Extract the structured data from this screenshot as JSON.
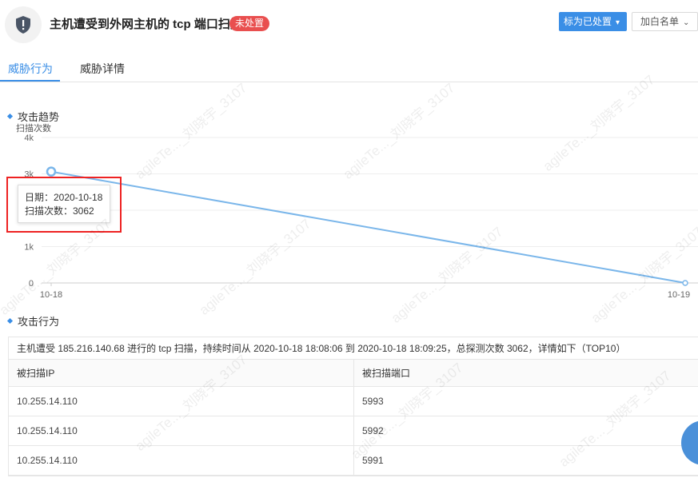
{
  "header": {
    "title": "主机遭受到外网主机的 tcp 端口扫描",
    "status_badge": "未处置",
    "mark_button": "标为已处置",
    "whitelist_button": "加白名单"
  },
  "tabs": [
    {
      "label": "威胁行为",
      "active": true
    },
    {
      "label": "威胁详情",
      "active": false
    }
  ],
  "trend_section": {
    "title": "攻击趋势",
    "y_axis_title": "扫描次数"
  },
  "tooltip": {
    "date_line": "日期：2020-10-18",
    "count_line": "扫描次数：3062"
  },
  "chart_data": {
    "type": "line",
    "x": [
      "10-18",
      "10-19"
    ],
    "series": [
      {
        "values": [
          3062,
          0
        ]
      }
    ],
    "ylabel": "扫描次数",
    "ylim": [
      0,
      4000
    ],
    "yticks": [
      "0",
      "1k",
      "2k",
      "3k",
      "4k"
    ],
    "color": "#7ab6ea",
    "grid": true
  },
  "behavior_section": {
    "title": "攻击行为",
    "summary": "主机遭受 185.216.140.68 进行的 tcp 扫描，持续时间从 2020-10-18 18:08:06 到 2020-10-18 18:09:25，总探测次数 3062，详情如下（TOP10）",
    "columns": [
      "被扫描IP",
      "被扫描端口"
    ],
    "rows": [
      [
        "10.255.14.110",
        "5993"
      ],
      [
        "10.255.14.110",
        "5992"
      ],
      [
        "10.255.14.110",
        "5991"
      ]
    ]
  },
  "watermark": "agileTe..._刘晓宇_3107",
  "colors": {
    "accent": "#3a8ee6",
    "danger": "#e94f4f",
    "line": "#7ab6ea"
  }
}
